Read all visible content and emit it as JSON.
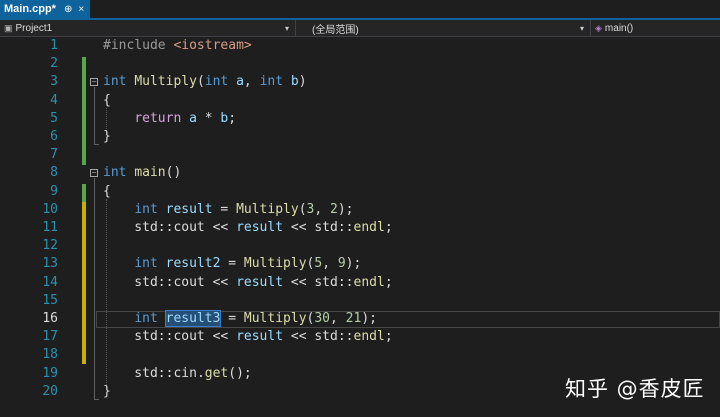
{
  "tab": {
    "label": "Main.cpp*",
    "pin_glyph": "⊕",
    "close_glyph": "×"
  },
  "navbar": {
    "project": "Project1",
    "scope": "(全局范围)",
    "member": "main()"
  },
  "editor": {
    "current_line": 16,
    "lines": [
      {
        "n": "1",
        "tokens": [
          {
            "c": "pre",
            "t": "#include "
          },
          {
            "c": "str",
            "t": "<iostream>"
          }
        ]
      },
      {
        "n": "2",
        "tokens": []
      },
      {
        "n": "3",
        "tokens": [
          {
            "c": "kw",
            "t": "int "
          },
          {
            "c": "fn",
            "t": "Multiply"
          },
          {
            "c": "",
            "t": "("
          },
          {
            "c": "kw",
            "t": "int"
          },
          {
            "c": "var",
            "t": " a"
          },
          {
            "c": "",
            "t": ", "
          },
          {
            "c": "kw",
            "t": "int"
          },
          {
            "c": "var",
            "t": " b"
          },
          {
            "c": "",
            "t": ")"
          }
        ]
      },
      {
        "n": "4",
        "tokens": [
          {
            "c": "",
            "t": "{"
          }
        ]
      },
      {
        "n": "5",
        "tokens": [
          {
            "c": "",
            "t": "    "
          },
          {
            "c": "kw2",
            "t": "return"
          },
          {
            "c": "var",
            "t": " a"
          },
          {
            "c": "",
            "t": " * "
          },
          {
            "c": "var",
            "t": "b"
          },
          {
            "c": "",
            "t": ";"
          }
        ]
      },
      {
        "n": "6",
        "tokens": [
          {
            "c": "",
            "t": "}"
          }
        ]
      },
      {
        "n": "7",
        "tokens": []
      },
      {
        "n": "8",
        "tokens": [
          {
            "c": "kw",
            "t": "int "
          },
          {
            "c": "fn",
            "t": "main"
          },
          {
            "c": "",
            "t": "()"
          }
        ]
      },
      {
        "n": "9",
        "tokens": [
          {
            "c": "",
            "t": "{"
          }
        ]
      },
      {
        "n": "10",
        "tokens": [
          {
            "c": "",
            "t": "    "
          },
          {
            "c": "kw",
            "t": "int"
          },
          {
            "c": "var",
            "t": " result"
          },
          {
            "c": "",
            "t": " = "
          },
          {
            "c": "fn",
            "t": "Multiply"
          },
          {
            "c": "",
            "t": "("
          },
          {
            "c": "num",
            "t": "3"
          },
          {
            "c": "",
            "t": ", "
          },
          {
            "c": "num",
            "t": "2"
          },
          {
            "c": "",
            "t": ");"
          }
        ]
      },
      {
        "n": "11",
        "tokens": [
          {
            "c": "",
            "t": "    std::"
          },
          {
            "c": "",
            "t": "cout"
          },
          {
            "c": "",
            "t": " << "
          },
          {
            "c": "var",
            "t": "result"
          },
          {
            "c": "",
            "t": " << std::"
          },
          {
            "c": "fn",
            "t": "endl"
          },
          {
            "c": "",
            "t": ";"
          }
        ]
      },
      {
        "n": "12",
        "tokens": []
      },
      {
        "n": "13",
        "tokens": [
          {
            "c": "",
            "t": "    "
          },
          {
            "c": "kw",
            "t": "int"
          },
          {
            "c": "var",
            "t": " result2"
          },
          {
            "c": "",
            "t": " = "
          },
          {
            "c": "fn",
            "t": "Multiply"
          },
          {
            "c": "",
            "t": "("
          },
          {
            "c": "num",
            "t": "5"
          },
          {
            "c": "",
            "t": ", "
          },
          {
            "c": "num",
            "t": "9"
          },
          {
            "c": "",
            "t": ");"
          }
        ]
      },
      {
        "n": "14",
        "tokens": [
          {
            "c": "",
            "t": "    std::"
          },
          {
            "c": "",
            "t": "cout"
          },
          {
            "c": "",
            "t": " << "
          },
          {
            "c": "var",
            "t": "result"
          },
          {
            "c": "",
            "t": " << std::"
          },
          {
            "c": "fn",
            "t": "endl"
          },
          {
            "c": "",
            "t": ";"
          }
        ]
      },
      {
        "n": "15",
        "tokens": []
      },
      {
        "n": "16",
        "tokens": [
          {
            "c": "",
            "t": "    "
          },
          {
            "c": "kw",
            "t": "int"
          },
          {
            "c": "",
            "t": " "
          },
          {
            "c": "var sel",
            "t": "result3"
          },
          {
            "c": "",
            "t": " = "
          },
          {
            "c": "fn",
            "t": "Multiply"
          },
          {
            "c": "",
            "t": "("
          },
          {
            "c": "num",
            "t": "30"
          },
          {
            "c": "",
            "t": ", "
          },
          {
            "c": "num",
            "t": "21"
          },
          {
            "c": "",
            "t": ");"
          }
        ]
      },
      {
        "n": "17",
        "tokens": [
          {
            "c": "",
            "t": "    std::"
          },
          {
            "c": "",
            "t": "cout"
          },
          {
            "c": "",
            "t": " << "
          },
          {
            "c": "var",
            "t": "result"
          },
          {
            "c": "",
            "t": " << std::"
          },
          {
            "c": "fn",
            "t": "endl"
          },
          {
            "c": "",
            "t": ";"
          }
        ]
      },
      {
        "n": "18",
        "tokens": []
      },
      {
        "n": "19",
        "tokens": [
          {
            "c": "",
            "t": "    std::"
          },
          {
            "c": "",
            "t": "cin"
          },
          {
            "c": "",
            "t": "."
          },
          {
            "c": "fn",
            "t": "get"
          },
          {
            "c": "",
            "t": "();"
          }
        ]
      },
      {
        "n": "20",
        "tokens": [
          {
            "c": "",
            "t": "}"
          }
        ]
      }
    ]
  },
  "watermark": "知乎 @香皮匠"
}
